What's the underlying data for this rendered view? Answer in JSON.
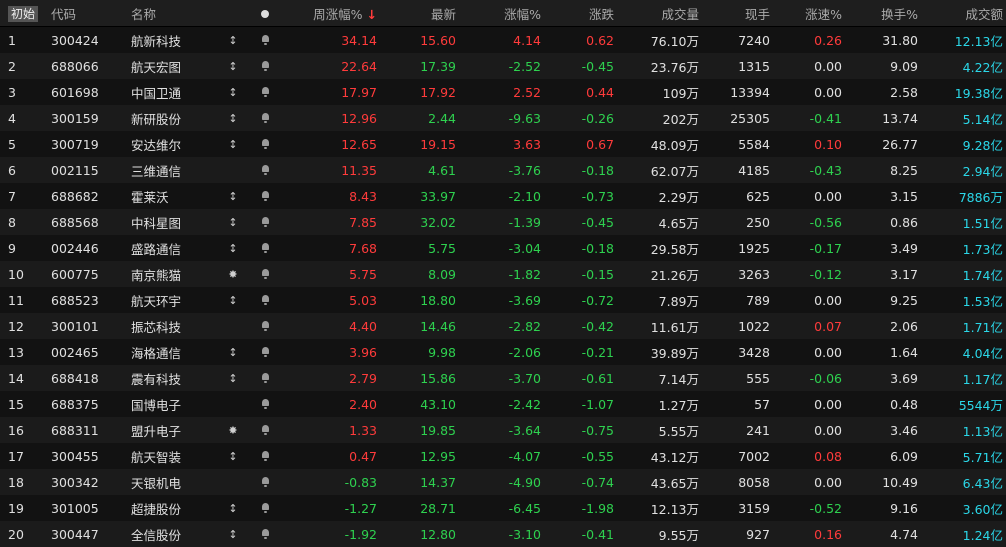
{
  "header": {
    "idx": "初始",
    "code": "代码",
    "name": "名称",
    "week_change": "周涨幅%",
    "sort_arrow": "↓",
    "latest": "最新",
    "change_pct": "涨幅%",
    "change": "涨跌",
    "volume": "成交量",
    "current_hand": "现手",
    "speed": "涨速%",
    "turnover": "换手%",
    "amount": "成交额"
  },
  "colors": {
    "up": "#ff3b3b",
    "down": "#2ed14f",
    "flat": "#e0e0e0",
    "amount": "#2bd7e8"
  },
  "rows": [
    {
      "idx": "1",
      "code": "300424",
      "name": "航新科技",
      "mark": "↕",
      "wk": "34.14",
      "wk_c": "red",
      "px": "15.60",
      "px_c": "red",
      "pct": "4.14",
      "pct_c": "red",
      "chg": "0.62",
      "chg_c": "red",
      "vol": "76.10万",
      "hand": "7240",
      "spd": "0.26",
      "spd_c": "red",
      "tr": "31.80",
      "amt": "12.13亿"
    },
    {
      "idx": "2",
      "code": "688066",
      "name": "航天宏图",
      "mark": "↕",
      "wk": "22.64",
      "wk_c": "red",
      "px": "17.39",
      "px_c": "green",
      "pct": "-2.52",
      "pct_c": "green",
      "chg": "-0.45",
      "chg_c": "green",
      "vol": "23.76万",
      "hand": "1315",
      "spd": "0.00",
      "spd_c": "white",
      "tr": "9.09",
      "amt": "4.22亿"
    },
    {
      "idx": "3",
      "code": "601698",
      "name": "中国卫通",
      "mark": "↕",
      "wk": "17.97",
      "wk_c": "red",
      "px": "17.92",
      "px_c": "red",
      "pct": "2.52",
      "pct_c": "red",
      "chg": "0.44",
      "chg_c": "red",
      "vol": "109万",
      "hand": "13394",
      "spd": "0.00",
      "spd_c": "white",
      "tr": "2.58",
      "amt": "19.38亿"
    },
    {
      "idx": "4",
      "code": "300159",
      "name": "新研股份",
      "mark": "↕",
      "wk": "12.96",
      "wk_c": "red",
      "px": "2.44",
      "px_c": "green",
      "pct": "-9.63",
      "pct_c": "green",
      "chg": "-0.26",
      "chg_c": "green",
      "vol": "202万",
      "hand": "25305",
      "spd": "-0.41",
      "spd_c": "green",
      "tr": "13.74",
      "amt": "5.14亿"
    },
    {
      "idx": "5",
      "code": "300719",
      "name": "安达维尔",
      "mark": "↕",
      "wk": "12.65",
      "wk_c": "red",
      "px": "19.15",
      "px_c": "red",
      "pct": "3.63",
      "pct_c": "red",
      "chg": "0.67",
      "chg_c": "red",
      "vol": "48.09万",
      "hand": "5584",
      "spd": "0.10",
      "spd_c": "red",
      "tr": "26.77",
      "amt": "9.28亿"
    },
    {
      "idx": "6",
      "code": "002115",
      "name": "三维通信",
      "mark": "",
      "wk": "11.35",
      "wk_c": "red",
      "px": "4.61",
      "px_c": "green",
      "pct": "-3.76",
      "pct_c": "green",
      "chg": "-0.18",
      "chg_c": "green",
      "vol": "62.07万",
      "hand": "4185",
      "spd": "-0.43",
      "spd_c": "green",
      "tr": "8.25",
      "amt": "2.94亿"
    },
    {
      "idx": "7",
      "code": "688682",
      "name": "霍莱沃",
      "mark": "↕",
      "wk": "8.43",
      "wk_c": "red",
      "px": "33.97",
      "px_c": "green",
      "pct": "-2.10",
      "pct_c": "green",
      "chg": "-0.73",
      "chg_c": "green",
      "vol": "2.29万",
      "hand": "625",
      "spd": "0.00",
      "spd_c": "white",
      "tr": "3.15",
      "amt": "7886万"
    },
    {
      "idx": "8",
      "code": "688568",
      "name": "中科星图",
      "mark": "↕",
      "wk": "7.85",
      "wk_c": "red",
      "px": "32.02",
      "px_c": "green",
      "pct": "-1.39",
      "pct_c": "green",
      "chg": "-0.45",
      "chg_c": "green",
      "vol": "4.65万",
      "hand": "250",
      "spd": "-0.56",
      "spd_c": "green",
      "tr": "0.86",
      "amt": "1.51亿"
    },
    {
      "idx": "9",
      "code": "002446",
      "name": "盛路通信",
      "mark": "↕",
      "wk": "7.68",
      "wk_c": "red",
      "px": "5.75",
      "px_c": "green",
      "pct": "-3.04",
      "pct_c": "green",
      "chg": "-0.18",
      "chg_c": "green",
      "vol": "29.58万",
      "hand": "1925",
      "spd": "-0.17",
      "spd_c": "green",
      "tr": "3.49",
      "amt": "1.73亿"
    },
    {
      "idx": "10",
      "code": "600775",
      "name": "南京熊猫",
      "mark": "✸",
      "wk": "5.75",
      "wk_c": "red",
      "px": "8.09",
      "px_c": "green",
      "pct": "-1.82",
      "pct_c": "green",
      "chg": "-0.15",
      "chg_c": "green",
      "vol": "21.26万",
      "hand": "3263",
      "spd": "-0.12",
      "spd_c": "green",
      "tr": "3.17",
      "amt": "1.74亿"
    },
    {
      "idx": "11",
      "code": "688523",
      "name": "航天环宇",
      "mark": "↕",
      "wk": "5.03",
      "wk_c": "red",
      "px": "18.80",
      "px_c": "green",
      "pct": "-3.69",
      "pct_c": "green",
      "chg": "-0.72",
      "chg_c": "green",
      "vol": "7.89万",
      "hand": "789",
      "spd": "0.00",
      "spd_c": "white",
      "tr": "9.25",
      "amt": "1.53亿"
    },
    {
      "idx": "12",
      "code": "300101",
      "name": "振芯科技",
      "mark": "",
      "wk": "4.40",
      "wk_c": "red",
      "px": "14.46",
      "px_c": "green",
      "pct": "-2.82",
      "pct_c": "green",
      "chg": "-0.42",
      "chg_c": "green",
      "vol": "11.61万",
      "hand": "1022",
      "spd": "0.07",
      "spd_c": "red",
      "tr": "2.06",
      "amt": "1.71亿"
    },
    {
      "idx": "13",
      "code": "002465",
      "name": "海格通信",
      "mark": "↕",
      "wk": "3.96",
      "wk_c": "red",
      "px": "9.98",
      "px_c": "green",
      "pct": "-2.06",
      "pct_c": "green",
      "chg": "-0.21",
      "chg_c": "green",
      "vol": "39.89万",
      "hand": "3428",
      "spd": "0.00",
      "spd_c": "white",
      "tr": "1.64",
      "amt": "4.04亿"
    },
    {
      "idx": "14",
      "code": "688418",
      "name": "震有科技",
      "mark": "↕",
      "wk": "2.79",
      "wk_c": "red",
      "px": "15.86",
      "px_c": "green",
      "pct": "-3.70",
      "pct_c": "green",
      "chg": "-0.61",
      "chg_c": "green",
      "vol": "7.14万",
      "hand": "555",
      "spd": "-0.06",
      "spd_c": "green",
      "tr": "3.69",
      "amt": "1.17亿"
    },
    {
      "idx": "15",
      "code": "688375",
      "name": "国博电子",
      "mark": "",
      "wk": "2.40",
      "wk_c": "red",
      "px": "43.10",
      "px_c": "green",
      "pct": "-2.42",
      "pct_c": "green",
      "chg": "-1.07",
      "chg_c": "green",
      "vol": "1.27万",
      "hand": "57",
      "spd": "0.00",
      "spd_c": "white",
      "tr": "0.48",
      "amt": "5544万"
    },
    {
      "idx": "16",
      "code": "688311",
      "name": "盟升电子",
      "mark": "✸",
      "wk": "1.33",
      "wk_c": "red",
      "px": "19.85",
      "px_c": "green",
      "pct": "-3.64",
      "pct_c": "green",
      "chg": "-0.75",
      "chg_c": "green",
      "vol": "5.55万",
      "hand": "241",
      "spd": "0.00",
      "spd_c": "white",
      "tr": "3.46",
      "amt": "1.13亿"
    },
    {
      "idx": "17",
      "code": "300455",
      "name": "航天智装",
      "mark": "↕",
      "wk": "0.47",
      "wk_c": "red",
      "px": "12.95",
      "px_c": "green",
      "pct": "-4.07",
      "pct_c": "green",
      "chg": "-0.55",
      "chg_c": "green",
      "vol": "43.12万",
      "hand": "7002",
      "spd": "0.08",
      "spd_c": "red",
      "tr": "6.09",
      "amt": "5.71亿"
    },
    {
      "idx": "18",
      "code": "300342",
      "name": "天银机电",
      "mark": "",
      "wk": "-0.83",
      "wk_c": "green",
      "px": "14.37",
      "px_c": "green",
      "pct": "-4.90",
      "pct_c": "green",
      "chg": "-0.74",
      "chg_c": "green",
      "vol": "43.65万",
      "hand": "8058",
      "spd": "0.00",
      "spd_c": "white",
      "tr": "10.49",
      "amt": "6.43亿"
    },
    {
      "idx": "19",
      "code": "301005",
      "name": "超捷股份",
      "mark": "↕",
      "wk": "-1.27",
      "wk_c": "green",
      "px": "28.71",
      "px_c": "green",
      "pct": "-6.45",
      "pct_c": "green",
      "chg": "-1.98",
      "chg_c": "green",
      "vol": "12.13万",
      "hand": "3159",
      "spd": "-0.52",
      "spd_c": "green",
      "tr": "9.16",
      "amt": "3.60亿"
    },
    {
      "idx": "20",
      "code": "300447",
      "name": "全信股份",
      "mark": "↕",
      "wk": "-1.92",
      "wk_c": "green",
      "px": "12.80",
      "px_c": "green",
      "pct": "-3.10",
      "pct_c": "green",
      "chg": "-0.41",
      "chg_c": "green",
      "vol": "9.55万",
      "hand": "927",
      "spd": "0.16",
      "spd_c": "red",
      "tr": "4.74",
      "amt": "1.24亿"
    }
  ]
}
